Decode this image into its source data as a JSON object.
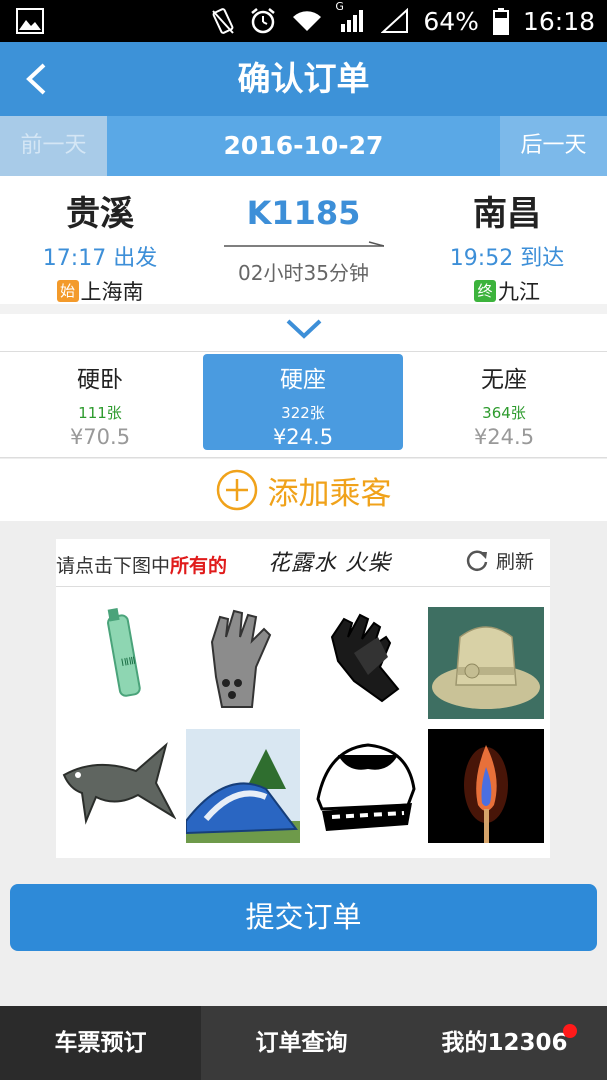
{
  "status_bar": {
    "battery": "64%",
    "time": "16:18",
    "network": "G"
  },
  "header": {
    "title": "确认订单"
  },
  "date_bar": {
    "prev_label": "前一天",
    "date": "2016-10-27",
    "next_label": "后一天"
  },
  "train": {
    "from_station": "贵溪",
    "depart_time": "17:17 出发",
    "start_badge": "始",
    "start_station": "上海南",
    "train_no": "K1185",
    "duration": "02小时35分钟",
    "to_station": "南昌",
    "arrive_time": "19:52 到达",
    "end_badge": "终",
    "end_station": "九江"
  },
  "seats": [
    {
      "type": "硬卧",
      "count": "111张",
      "price": "¥70.5",
      "selected": false
    },
    {
      "type": "硬座",
      "count": "322张",
      "price": "¥24.5",
      "selected": true
    },
    {
      "type": "无座",
      "count": "364张",
      "price": "¥24.5",
      "selected": false
    }
  ],
  "add_passenger": {
    "label": "添加乘客"
  },
  "captcha": {
    "instruction_prefix": "请点击下图中",
    "instruction_emphasis": "所有的",
    "targets": "花露水  火柴",
    "refresh_label": "刷新",
    "images": [
      "test-tube-icon",
      "glove-icon",
      "leather-glove-icon",
      "hat-icon",
      "fish-icon",
      "tent-icon",
      "sketch-icon",
      "match-flame-icon"
    ]
  },
  "submit": {
    "label": "提交订单"
  },
  "tab_bar": {
    "tabs": [
      "车票预订",
      "订单查询",
      "我的12306"
    ],
    "active_index": 0
  },
  "colors": {
    "primary": "#3d92d8",
    "accent_orange": "#f0a21a",
    "count_green": "#2e9b2e",
    "notification_red": "#ff1a1a"
  }
}
